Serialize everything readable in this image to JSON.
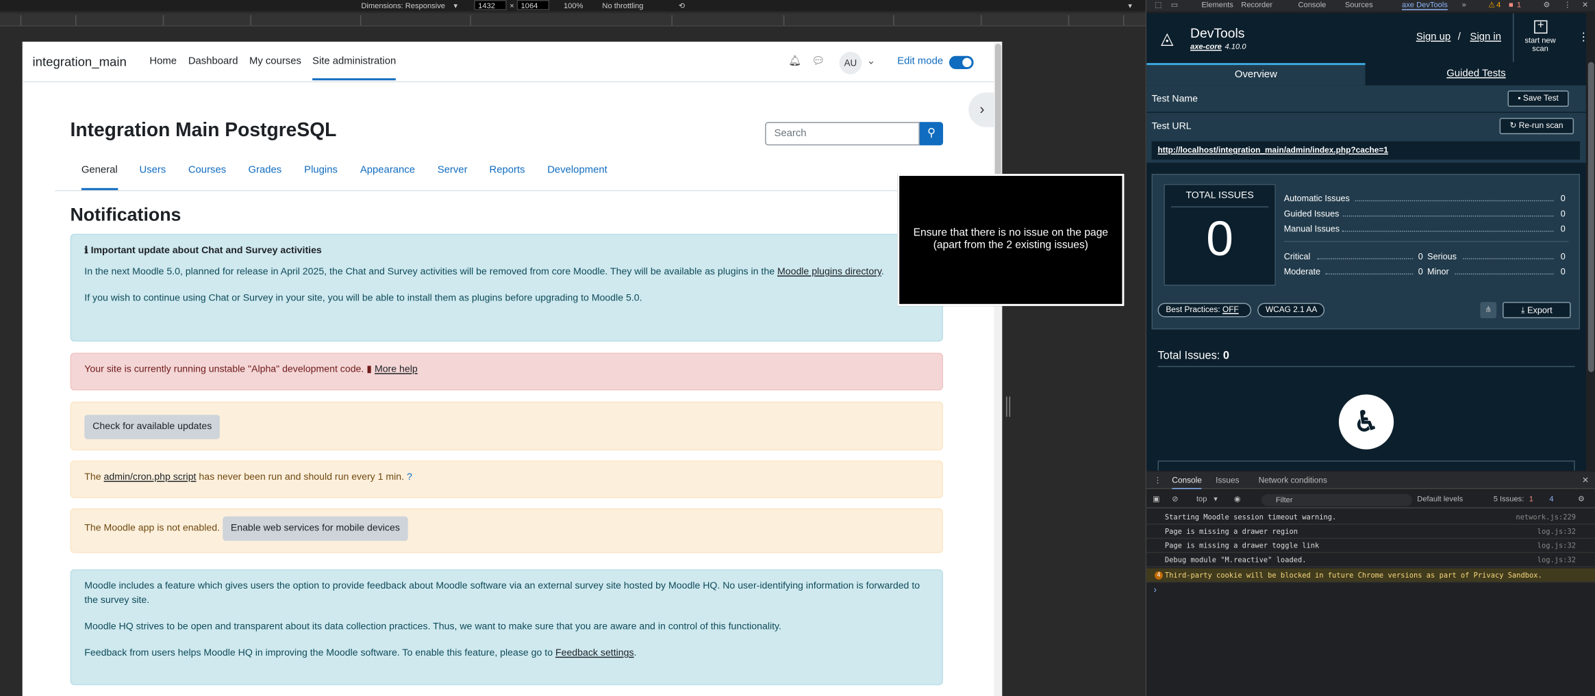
{
  "devbar": {
    "dimensions": "Dimensions: Responsive",
    "width": "1432",
    "x": "×",
    "height": "1064",
    "zoom": "100%",
    "throttle": "No throttling"
  },
  "nav": {
    "brand": "integration_main",
    "home": "Home",
    "dashboard": "Dashboard",
    "mycourses": "My courses",
    "siteadmin": "Site administration",
    "avatar": "AU",
    "editmode": "Edit mode"
  },
  "page": {
    "title": "Integration Main PostgreSQL",
    "search_placeholder": "Search",
    "tabs": [
      "General",
      "Users",
      "Courses",
      "Grades",
      "Plugins",
      "Appearance",
      "Server",
      "Reports",
      "Development"
    ],
    "heading": "Notifications",
    "chat_title": "Important update about Chat and Survey activities",
    "chat_p1": "In the next Moodle 5.0, planned for release in April 2025, the Chat and Survey activities will be removed from core Moodle. They will be available as plugins in the ",
    "chat_link": "Moodle plugins directory",
    "chat_p2": "If you wish to continue using Chat or Survey in your site, you will be able to install them as plugins before upgrading to Moodle 5.0.",
    "alpha": "Your site is currently running unstable \"Alpha\" development code.",
    "morehelp": "More help",
    "check_updates": "Check for available updates",
    "cron_pre": "The ",
    "cron_link": "admin/cron.php script",
    "cron_post": " has never been run and should run every 1 min.",
    "app": "The Moodle app is not enabled.",
    "enable_ws": "Enable web services for mobile devices",
    "fb1": "Moodle includes a feature which gives users the option to provide feedback about Moodle software via an external survey site hosted by Moodle HQ. No user-identifying information is forwarded to the survey site.",
    "fb2": "Moodle HQ strives to be open and transparent about its data collection practices. Thus, we want to make sure that you are aware and in control of this functionality.",
    "fb3": "Feedback from users helps Moodle HQ in improving the Moodle software. To enable this feature, please go to ",
    "fb_link": "Feedback settings"
  },
  "tooltip": "Ensure that there is no issue on the page (apart from the 2 existing issues)",
  "devtools": {
    "tabs": [
      "Elements",
      "Recorder",
      "Console",
      "Sources",
      "axe DevTools"
    ],
    "warn_count": "4",
    "err_count": "1"
  },
  "axe": {
    "title": "DevTools",
    "version_prefix": "axe-core",
    "version": "4.10.0",
    "signup": "Sign up",
    "slash": "/",
    "signin": "Sign in",
    "newscan": "start new scan",
    "tab_overview": "Overview",
    "tab_guided": "Guided Tests",
    "test_name": "Test Name",
    "save": "Save Test",
    "test_url": "Test URL",
    "rerun": "Re-run scan",
    "url": "http://localhost/integration_main/admin/index.php?cache=1",
    "total_label": "TOTAL ISSUES",
    "total": "0",
    "automatic": "Automatic Issues",
    "automatic_v": "0",
    "guided": "Guided Issues",
    "guided_v": "0",
    "manual": "Manual Issues",
    "manual_v": "0",
    "critical": "Critical",
    "critical_v": "0",
    "serious": "Serious",
    "serious_v": "0",
    "moderate": "Moderate",
    "moderate_v": "0",
    "minor": "Minor",
    "minor_v": "0",
    "bp": "Best Practices:",
    "bp_v": "OFF",
    "wcag": "WCAG 2.1 AA",
    "export": "Export",
    "total_issues": "Total Issues:",
    "total_issues_v": "0"
  },
  "console": {
    "tabs": [
      "Console",
      "Issues",
      "Network conditions"
    ],
    "top": "top",
    "filter": "Filter",
    "levels": "Default levels",
    "issues": "5 Issues:",
    "i1": "1",
    "i2": "4",
    "lines": [
      {
        "m": "Starting Moodle session timeout warning.",
        "s": "network.js:229"
      },
      {
        "m": "Page is missing a drawer region",
        "s": "log.js:32"
      },
      {
        "m": "Page is missing a drawer toggle link",
        "s": "log.js:32"
      },
      {
        "m": "Debug module \"M.reactive\" loaded.",
        "s": "log.js:32"
      }
    ],
    "warn_badge": "4",
    "warn": "Third-party cookie will be blocked in future Chrome versions as part of Privacy Sandbox."
  }
}
